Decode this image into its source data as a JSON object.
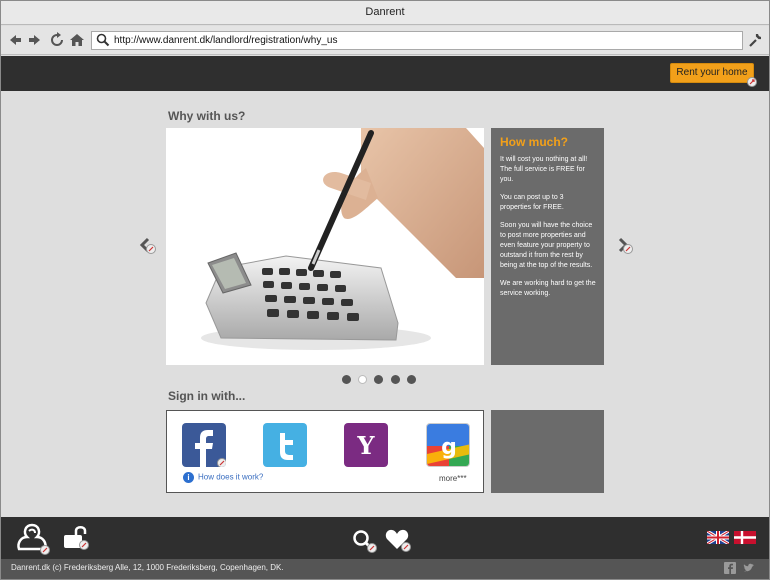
{
  "window": {
    "title": "Danrent"
  },
  "browser": {
    "url": "http://www.danrent.dk/landlord/registration/why_us"
  },
  "header": {
    "rent_button": "Rent your home"
  },
  "carousel": {
    "heading": "Why with us?",
    "panel_title": "How much?",
    "paragraphs": [
      "It will cost you nothing at all! The full service is FREE for you.",
      "You can post up to 3 properties for FREE.",
      "Soon you will have the choice to post more properties and even feature your property to outstand it from the rest by being at the top of the results.",
      "We are working hard to get the service working."
    ],
    "dots": 5,
    "active_dot": 1
  },
  "signin": {
    "heading": "Sign in with...",
    "providers": [
      "facebook-icon",
      "twitter-icon",
      "yahoo-icon",
      "google-icon"
    ],
    "how_link": "How does it work?",
    "more_link": "more***"
  },
  "footer": {
    "copyright": "Danrent.dk (c) Frederiksberg Alle, 12, 1000 Frederiksberg, Copenhagen, DK."
  },
  "colors": {
    "accent": "#f2a01a",
    "dark": "#2f2f2f",
    "panel": "#6b6b6b"
  }
}
